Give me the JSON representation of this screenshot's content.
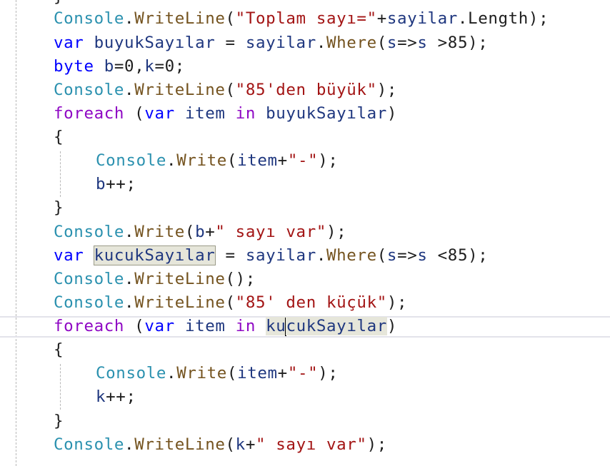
{
  "editor": {
    "lines": [
      {
        "tokens": [
          {
            "t": "}",
            "c": "plain"
          }
        ]
      },
      {
        "tokens": [
          {
            "t": "Console",
            "c": "type"
          },
          {
            "t": ".",
            "c": "plain"
          },
          {
            "t": "WriteLine",
            "c": "method"
          },
          {
            "t": "(",
            "c": "plain"
          },
          {
            "t": "\"Toplam sayı=\"",
            "c": "string"
          },
          {
            "t": "+",
            "c": "plain"
          },
          {
            "t": "sayilar",
            "c": "var"
          },
          {
            "t": ".Length);",
            "c": "plain"
          }
        ]
      },
      {
        "tokens": [
          {
            "t": "var",
            "c": "kw"
          },
          {
            "t": " ",
            "c": "plain"
          },
          {
            "t": "buyukSayılar",
            "c": "var"
          },
          {
            "t": " = ",
            "c": "plain"
          },
          {
            "t": "sayilar",
            "c": "var"
          },
          {
            "t": ".",
            "c": "plain"
          },
          {
            "t": "Where",
            "c": "method"
          },
          {
            "t": "(",
            "c": "plain"
          },
          {
            "t": "s",
            "c": "var"
          },
          {
            "t": "=>",
            "c": "plain"
          },
          {
            "t": "s",
            "c": "var"
          },
          {
            "t": " >85);",
            "c": "plain"
          }
        ]
      },
      {
        "tokens": [
          {
            "t": "byte",
            "c": "kw"
          },
          {
            "t": " ",
            "c": "plain"
          },
          {
            "t": "b",
            "c": "var"
          },
          {
            "t": "=0,",
            "c": "plain"
          },
          {
            "t": "k",
            "c": "var"
          },
          {
            "t": "=0;",
            "c": "plain"
          }
        ]
      },
      {
        "tokens": [
          {
            "t": "Console",
            "c": "type"
          },
          {
            "t": ".",
            "c": "plain"
          },
          {
            "t": "WriteLine",
            "c": "method"
          },
          {
            "t": "(",
            "c": "plain"
          },
          {
            "t": "\"85'den büyük\"",
            "c": "string"
          },
          {
            "t": ");",
            "c": "plain"
          }
        ]
      },
      {
        "tokens": [
          {
            "t": "foreach",
            "c": "ctrl"
          },
          {
            "t": " (",
            "c": "plain"
          },
          {
            "t": "var",
            "c": "kw"
          },
          {
            "t": " ",
            "c": "plain"
          },
          {
            "t": "item",
            "c": "var"
          },
          {
            "t": " ",
            "c": "plain"
          },
          {
            "t": "in",
            "c": "ctrl"
          },
          {
            "t": " ",
            "c": "plain"
          },
          {
            "t": "buyukSayılar",
            "c": "var"
          },
          {
            "t": ")",
            "c": "plain"
          }
        ]
      },
      {
        "tokens": [
          {
            "t": "{",
            "c": "plain"
          }
        ]
      },
      {
        "tokens": [
          {
            "t": "Console",
            "c": "type"
          },
          {
            "t": ".",
            "c": "plain"
          },
          {
            "t": "Write",
            "c": "method"
          },
          {
            "t": "(",
            "c": "plain"
          },
          {
            "t": "item",
            "c": "var"
          },
          {
            "t": "+",
            "c": "plain"
          },
          {
            "t": "\"-\"",
            "c": "string"
          },
          {
            "t": ");",
            "c": "plain"
          }
        ]
      },
      {
        "tokens": [
          {
            "t": "b",
            "c": "var"
          },
          {
            "t": "++;",
            "c": "plain"
          }
        ]
      },
      {
        "tokens": [
          {
            "t": "}",
            "c": "plain"
          }
        ]
      },
      {
        "tokens": [
          {
            "t": "Console",
            "c": "type"
          },
          {
            "t": ".",
            "c": "plain"
          },
          {
            "t": "Write",
            "c": "method"
          },
          {
            "t": "(",
            "c": "plain"
          },
          {
            "t": "b",
            "c": "var"
          },
          {
            "t": "+",
            "c": "plain"
          },
          {
            "t": "\" sayı var\"",
            "c": "string"
          },
          {
            "t": ");",
            "c": "plain"
          }
        ]
      },
      {
        "tokens": [
          {
            "t": "var",
            "c": "kw"
          },
          {
            "t": " ",
            "c": "plain"
          },
          {
            "t": "kucukSayılar",
            "c": "var",
            "hl": "ref"
          },
          {
            "t": " = ",
            "c": "plain"
          },
          {
            "t": "sayilar",
            "c": "var"
          },
          {
            "t": ".",
            "c": "plain"
          },
          {
            "t": "Where",
            "c": "method"
          },
          {
            "t": "(",
            "c": "plain"
          },
          {
            "t": "s",
            "c": "var"
          },
          {
            "t": "=>",
            "c": "plain"
          },
          {
            "t": "s",
            "c": "var"
          },
          {
            "t": " <85);",
            "c": "plain"
          }
        ]
      },
      {
        "tokens": [
          {
            "t": "Console",
            "c": "type"
          },
          {
            "t": ".",
            "c": "plain"
          },
          {
            "t": "WriteLine",
            "c": "method"
          },
          {
            "t": "();",
            "c": "plain"
          }
        ]
      },
      {
        "tokens": [
          {
            "t": "Console",
            "c": "type"
          },
          {
            "t": ".",
            "c": "plain"
          },
          {
            "t": "WriteLine",
            "c": "method"
          },
          {
            "t": "(",
            "c": "plain"
          },
          {
            "t": "\"85' den küçük\"",
            "c": "string"
          },
          {
            "t": ");",
            "c": "plain"
          }
        ]
      },
      {
        "tokens": [
          {
            "t": "foreach",
            "c": "ctrl"
          },
          {
            "t": " (",
            "c": "plain"
          },
          {
            "t": "var",
            "c": "kw"
          },
          {
            "t": " ",
            "c": "plain"
          },
          {
            "t": "item",
            "c": "var"
          },
          {
            "t": " ",
            "c": "plain"
          },
          {
            "t": "in",
            "c": "ctrl"
          },
          {
            "t": " ",
            "c": "plain"
          },
          {
            "t": "ku",
            "c": "var",
            "hl": "cursor"
          },
          {
            "caret": true
          },
          {
            "t": "cukSayılar",
            "c": "var",
            "hl": "cursor"
          },
          {
            "t": ")",
            "c": "plain"
          }
        ]
      },
      {
        "tokens": [
          {
            "t": "{",
            "c": "plain"
          }
        ]
      },
      {
        "tokens": [
          {
            "t": "Console",
            "c": "type"
          },
          {
            "t": ".",
            "c": "plain"
          },
          {
            "t": "Write",
            "c": "method"
          },
          {
            "t": "(",
            "c": "plain"
          },
          {
            "t": "item",
            "c": "var"
          },
          {
            "t": "+",
            "c": "plain"
          },
          {
            "t": "\"-\"",
            "c": "string"
          },
          {
            "t": ");",
            "c": "plain"
          }
        ]
      },
      {
        "tokens": [
          {
            "t": "k",
            "c": "var"
          },
          {
            "t": "++;",
            "c": "plain"
          }
        ]
      },
      {
        "tokens": [
          {
            "t": "}",
            "c": "plain"
          }
        ]
      },
      {
        "tokens": [
          {
            "t": "Console",
            "c": "type"
          },
          {
            "t": ".",
            "c": "plain"
          },
          {
            "t": "WriteLine",
            "c": "method"
          },
          {
            "t": "(",
            "c": "plain"
          },
          {
            "t": "k",
            "c": "var"
          },
          {
            "t": "+",
            "c": "plain"
          },
          {
            "t": "\" sayı var\"",
            "c": "string"
          },
          {
            "t": ");",
            "c": "plain"
          }
        ]
      }
    ]
  }
}
